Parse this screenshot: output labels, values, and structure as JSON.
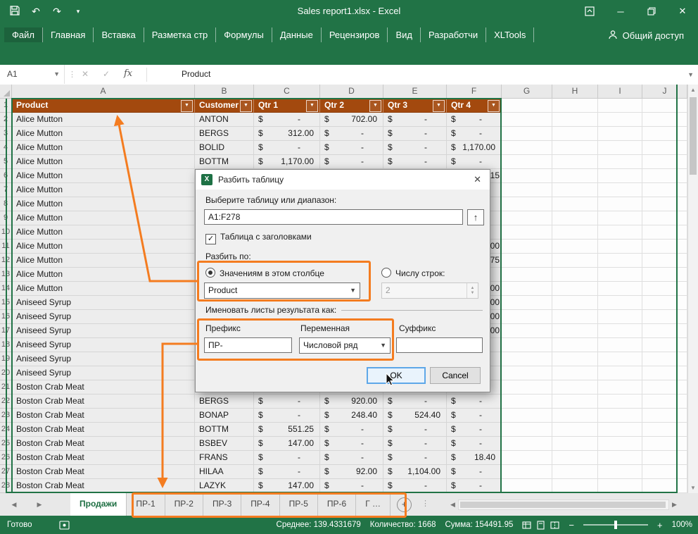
{
  "colors": {
    "excel_green": "#217346",
    "table_header_orange": "#A3490E",
    "annotation_orange": "#F47C20"
  },
  "title_bar": {
    "title": "Sales report1.xlsx - Excel"
  },
  "ribbon": {
    "tabs": [
      "Файл",
      "Главная",
      "Вставка",
      "Разметка стр",
      "Формулы",
      "Данные",
      "Рецензиров",
      "Вид",
      "Разработчи",
      "XLTools"
    ],
    "share_label": "Общий доступ"
  },
  "formula_bar": {
    "name_box": "A1",
    "fx": "fx",
    "content": "Product"
  },
  "grid": {
    "currency": "$",
    "columns": [
      "A",
      "B",
      "C",
      "D",
      "E",
      "F",
      "G",
      "H",
      "I",
      "J"
    ],
    "header": [
      "Product",
      "Customer",
      "Qtr 1",
      "Qtr 2",
      "Qtr 3",
      "Qtr 4"
    ],
    "rows": [
      {
        "n": 2,
        "product": "Alice Mutton",
        "customer": "ANTON",
        "q1": "-",
        "q2": "702.00",
        "q3": "-",
        "q4": "-"
      },
      {
        "n": 3,
        "product": "Alice Mutton",
        "customer": "BERGS",
        "q1": "312.00",
        "q2": "-",
        "q3": "-",
        "q4": "-"
      },
      {
        "n": 4,
        "product": "Alice Mutton",
        "customer": "BOLID",
        "q1": "-",
        "q2": "-",
        "q3": "-",
        "q4": "1,170.00"
      },
      {
        "n": 5,
        "product": "Alice Mutton",
        "customer": "BOTTM",
        "q1": "1,170.00",
        "q2": "-",
        "q3": "-",
        "q4": "-"
      },
      {
        "n": 6,
        "product": "Alice Mutton",
        "q4_visible": "15"
      },
      {
        "n": 7,
        "product": "Alice Mutton"
      },
      {
        "n": 8,
        "product": "Alice Mutton"
      },
      {
        "n": 9,
        "product": "Alice Mutton"
      },
      {
        "n": 10,
        "product": "Alice Mutton"
      },
      {
        "n": 11,
        "product": "Alice Mutton",
        "q4_visible": "00"
      },
      {
        "n": 12,
        "product": "Alice Mutton",
        "q4_visible": "75"
      },
      {
        "n": 13,
        "product": "Alice Mutton"
      },
      {
        "n": 14,
        "product": "Alice Mutton",
        "q4_visible": "00"
      },
      {
        "n": 15,
        "product": "Aniseed Syrup",
        "q4_visible": "00"
      },
      {
        "n": 16,
        "product": "Aniseed Syrup",
        "q4_visible": "00"
      },
      {
        "n": 17,
        "product": "Aniseed Syrup",
        "q4_visible": "00"
      },
      {
        "n": 18,
        "product": "Aniseed Syrup"
      },
      {
        "n": 19,
        "product": "Aniseed Syrup"
      },
      {
        "n": 20,
        "product": "Aniseed Syrup"
      },
      {
        "n": 21,
        "product": "Boston Crab Meat"
      },
      {
        "n": 22,
        "product": "Boston Crab Meat",
        "customer": "BERGS",
        "q1": "-",
        "q2": "920.00",
        "q3": "-",
        "q4": "-"
      },
      {
        "n": 23,
        "product": "Boston Crab Meat",
        "customer": "BONAP",
        "q1": "-",
        "q2": "248.40",
        "q3": "524.40",
        "q4": "-"
      },
      {
        "n": 24,
        "product": "Boston Crab Meat",
        "customer": "BOTTM",
        "q1": "551.25",
        "q2": "-",
        "q3": "-",
        "q4": "-"
      },
      {
        "n": 25,
        "product": "Boston Crab Meat",
        "customer": "BSBEV",
        "q1": "147.00",
        "q2": "-",
        "q3": "-",
        "q4": "-"
      },
      {
        "n": 26,
        "product": "Boston Crab Meat",
        "customer": "FRANS",
        "q1": "-",
        "q2": "-",
        "q3": "-",
        "q4": "18.40"
      },
      {
        "n": 27,
        "product": "Boston Crab Meat",
        "customer": "HILAA",
        "q1": "-",
        "q2": "92.00",
        "q3": "1,104.00",
        "q4": "-"
      },
      {
        "n": 28,
        "product": "Boston Crab Meat",
        "customer": "LAZYK",
        "q1": "147.00",
        "q2": "-",
        "q3": "-",
        "q4": "-"
      }
    ]
  },
  "dialog": {
    "title": "Разбить таблицу",
    "range_label": "Выберите таблицу или диапазон:",
    "range_value": "A1:F278",
    "headers_checkbox_label": "Таблица с заголовками",
    "split_by_label": "Разбить по:",
    "by_values_label": "Значениям в этом столбце",
    "column_value": "Product",
    "by_rows_label": "Числу строк:",
    "rows_count_value": "2",
    "naming_label": "Именовать листы результата как:",
    "prefix_label": "Префикс",
    "prefix_value": "ПР-",
    "variable_label": "Переменная",
    "variable_value": "Числовой ряд",
    "suffix_label": "Суффикс",
    "suffix_value": "",
    "ok_label": "OK",
    "cancel_label": "Cancel"
  },
  "sheet_tabs": {
    "active": "Продажи",
    "tabs": [
      "Продажи",
      "ПР-1",
      "ПР-2",
      "ПР-3",
      "ПР-4",
      "ПР-5",
      "ПР-6",
      "Г …"
    ]
  },
  "status_bar": {
    "ready": "Готово",
    "average": "Среднее: 139.4331679",
    "count": "Количество: 1668",
    "sum": "Сумма: 154491.95",
    "zoom": "100%"
  }
}
